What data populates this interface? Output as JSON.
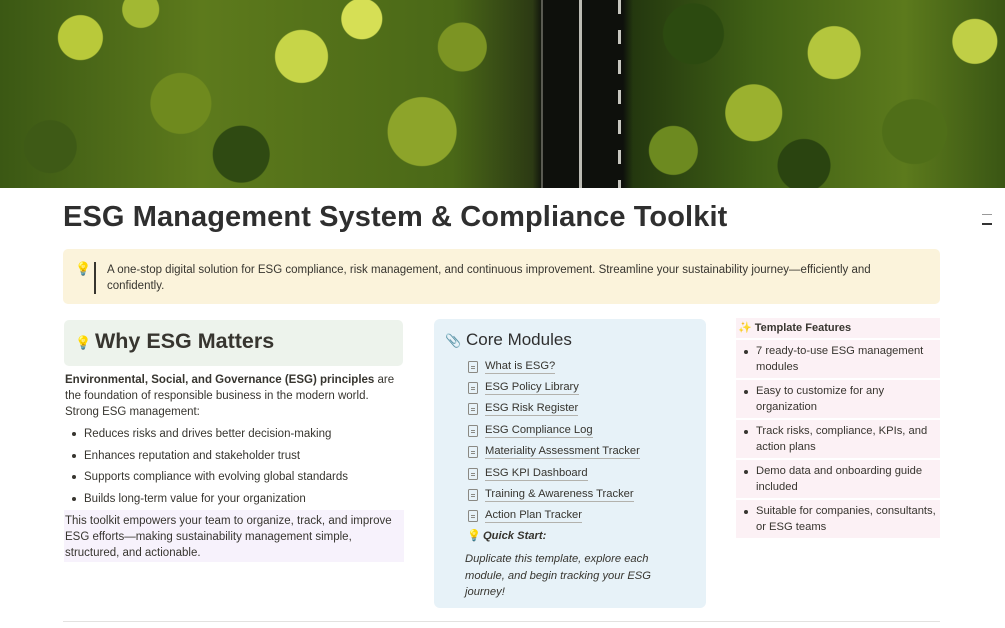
{
  "page": {
    "title": "ESG Management System & Compliance Toolkit"
  },
  "callout": {
    "icon": "lightbulb-icon",
    "text": "A one-stop digital solution for ESG compliance, risk management, and continuous improvement. Streamline your sustainability journey—efficiently and confidently."
  },
  "why": {
    "icon": "lightbulb-icon",
    "heading": "Why ESG Matters",
    "intro_bold": "Environmental, Social, and Governance (ESG) principles",
    "intro_rest": " are the foundation of responsible business in the modern world. Strong ESG management:",
    "bullets": [
      "Reduces risks and drives better decision-making",
      "Enhances reputation and stakeholder trust",
      "Supports compliance with evolving global standards",
      "Builds long-term value for your organization"
    ],
    "empower": "This toolkit empowers your team to organize, track, and improve ESG efforts—making sustainability management simple, structured, and actionable."
  },
  "modules": {
    "icon": "paperclip-icon",
    "heading": "Core Modules",
    "items": [
      "What is ESG?",
      "ESG Policy Library",
      "ESG Risk Register",
      "ESG Compliance Log",
      "Materiality Assessment Tracker",
      "ESG KPI Dashboard",
      "Training & Awareness Tracker",
      "Action Plan Tracker"
    ],
    "quick_start_label": "Quick Start:",
    "quick_start_text": "Duplicate this template, explore each module, and begin tracking your ESG journey!"
  },
  "features": {
    "icon": "sparkles-icon",
    "heading": "Template Features",
    "items": [
      "7 ready-to-use ESG management modules",
      "Easy to customize for any organization",
      "Track risks, compliance, KPIs, and action plans",
      "Demo data and onboarding guide included",
      "Suitable for companies, consultants, or ESG teams"
    ]
  },
  "colors": {
    "callout_bg": "#fbf3db",
    "why_bg": "#edf3ec",
    "modules_bg": "#e7f2f8",
    "features_bg": "#fcf1f5",
    "empower_bg": "#f7f2fc"
  }
}
